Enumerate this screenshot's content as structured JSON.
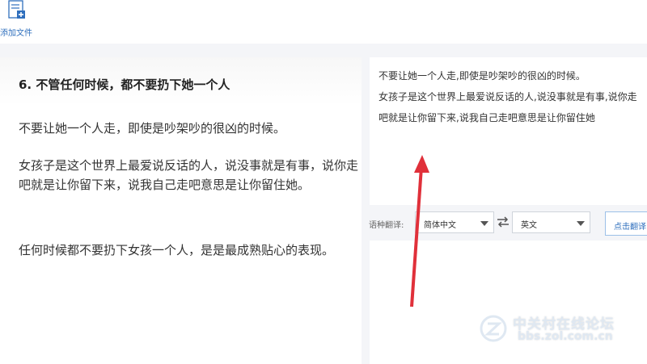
{
  "toolbar": {
    "add_file_label": "添加文件",
    "add_file_icon": "add-file-icon"
  },
  "document": {
    "heading": "6. 不管任何时候，都不要扔下她一个人",
    "paragraphs": [
      "不要让她一个人走，即使是吵架吵的很凶的时候。",
      "女孩子是这个世界上最爱说反话的人，说没事就是有事，说你走吧就是让你留下来，说我自己走吧意思是让你留住她。",
      "任何时候都不要扔下女孩一个人，是是最成熟贴心的表现。"
    ]
  },
  "source_text": {
    "lines": [
      "不要让她一个人走,即使是吵架吵的很凶的时候。",
      "女孩子是这个世界上最爱说反话的人,说没事就是有事,说你走吧就是让你留下来,说我自己走吧意思是让你留住她"
    ]
  },
  "language_bar": {
    "label": "语种翻译:",
    "from_value": "简体中文",
    "to_value": "英文",
    "swap_icon": "swap-arrows-icon",
    "translate_button": "点击翻译"
  },
  "watermark": {
    "title": "中关村在线论坛",
    "url": "bbs.zol.com.cn"
  },
  "colors": {
    "accent": "#2f6fbd",
    "annotation_arrow": "#e0303a"
  }
}
